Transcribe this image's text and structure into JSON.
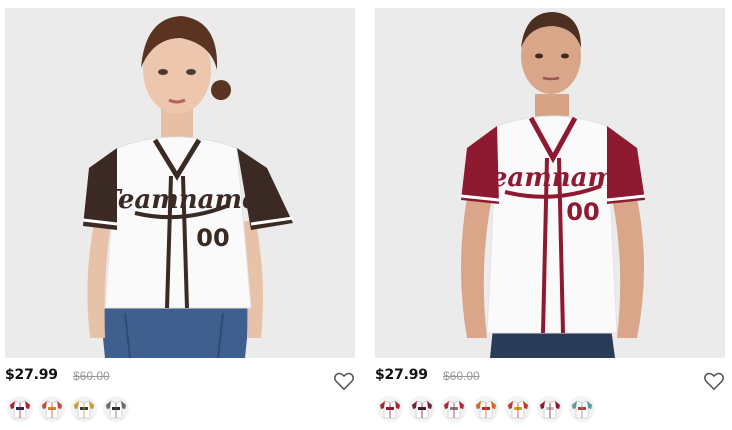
{
  "products": [
    {
      "price": "$27.99",
      "old_price": "$60.00",
      "jersey_text": "Teamname",
      "jersey_number": "00",
      "sleeve_color": "#3b2a24",
      "trim_color": "#3b2a24",
      "swatches": [
        {
          "trim": "#b0222e",
          "alt": "#1c2a5c"
        },
        {
          "trim": "#c94a3a",
          "alt": "#d08a2a"
        },
        {
          "trim": "#c9a227",
          "alt": "#3a3a3a"
        },
        {
          "trim": "#6b6b6b",
          "alt": "#2a2a2a"
        }
      ]
    },
    {
      "price": "$27.99",
      "old_price": "$60.00",
      "jersey_text": "Teamname",
      "jersey_number": "00",
      "sleeve_color": "#8e1a32",
      "trim_color": "#8e1a32",
      "swatches": [
        {
          "trim": "#a4283a",
          "alt": "#8e1a32"
        },
        {
          "trim": "#7a1f3c",
          "alt": "#3a1a2a"
        },
        {
          "trim": "#b3263a",
          "alt": "#7a7a7a"
        },
        {
          "trim": "#d2691e",
          "alt": "#b3263a"
        },
        {
          "trim": "#c0392b",
          "alt": "#d4a017"
        },
        {
          "trim": "#8e1a32",
          "alt": "#c0c0c0"
        },
        {
          "trim": "#5aa0a0",
          "alt": "#c0392b"
        }
      ]
    }
  ]
}
